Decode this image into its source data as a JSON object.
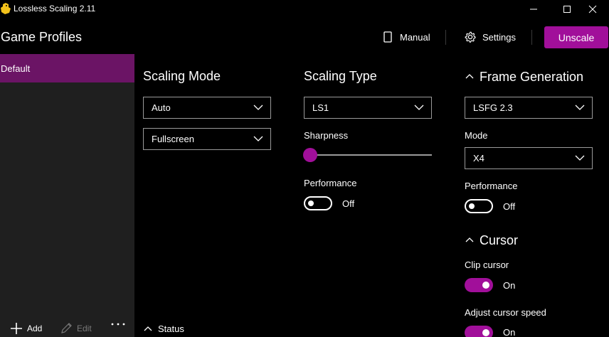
{
  "app": {
    "title": "Lossless Scaling 2.11"
  },
  "header": {
    "page_title": "Game Profiles",
    "manual_label": "Manual",
    "settings_label": "Settings",
    "unscale_label": "Unscale"
  },
  "sidebar": {
    "profiles": [
      {
        "label": "Default",
        "selected": true
      }
    ],
    "actions": {
      "add_label": "Add",
      "edit_label": "Edit"
    }
  },
  "scaling_mode": {
    "title": "Scaling Mode",
    "mode_value": "Auto",
    "window_value": "Fullscreen"
  },
  "scaling_type": {
    "title": "Scaling Type",
    "type_value": "LS1",
    "sharpness_label": "Sharpness",
    "sharpness_value": 0,
    "performance_label": "Performance",
    "performance_state": "Off"
  },
  "frame_generation": {
    "title": "Frame Generation",
    "version_value": "LSFG 2.3",
    "mode_label": "Mode",
    "mode_value": "X4",
    "performance_label": "Performance",
    "performance_state": "Off"
  },
  "cursor": {
    "title": "Cursor",
    "clip_label": "Clip cursor",
    "clip_state": "On",
    "speed_label": "Adjust cursor speed",
    "speed_state": "On"
  },
  "status": {
    "label": "Status"
  },
  "colors": {
    "accent": "#a10f9a",
    "selected_profile": "#6b1465",
    "sidebar_bg": "#1f1f1f",
    "background": "#000000"
  }
}
